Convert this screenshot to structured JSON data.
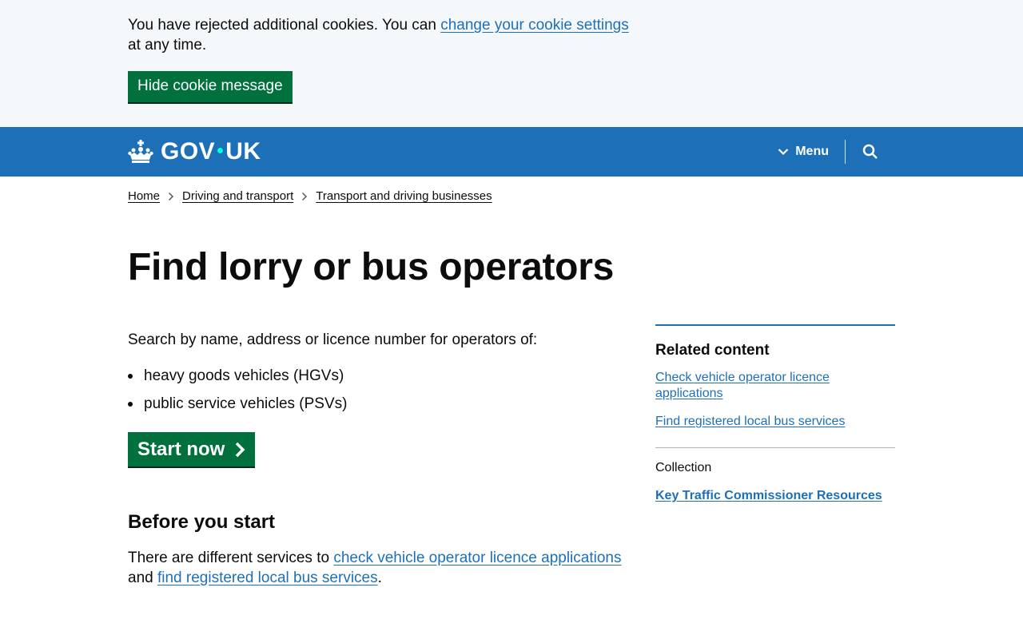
{
  "cookie_banner": {
    "message_before": "You have rejected additional cookies. You can ",
    "link_text": "change your cookie settings",
    "message_after": " at any time.",
    "hide_button": "Hide cookie message"
  },
  "header": {
    "logo_left": "GOV",
    "logo_right": "UK",
    "menu_label": "Menu",
    "icons": [
      "crown-icon",
      "chevron-down-icon",
      "search-icon"
    ]
  },
  "breadcrumb": [
    "Home",
    "Driving and transport",
    "Transport and driving businesses"
  ],
  "page": {
    "title": "Find lorry or bus operators",
    "intro": "Search by name, address or licence number for operators of:",
    "bullets": [
      "heavy goods vehicles (HGVs)",
      "public service vehicles (PSVs)"
    ],
    "start_button": "Start now",
    "before_heading": "Before you start",
    "before_text_1": "There are different services to ",
    "before_link_1": "check vehicle operator licence applications",
    "before_text_2": " and ",
    "before_link_2": "find registered local bus services",
    "before_text_3": "."
  },
  "sidebar": {
    "related_heading": "Related content",
    "related_links": [
      "Check vehicle operator licence applications",
      "Find registered local bus services"
    ],
    "collection_label": "Collection",
    "collection_links": [
      "Key Traffic Commissioner Resources"
    ]
  },
  "colors": {
    "brand_blue": "#1d70b8",
    "button_green": "#00703c",
    "banner_bg": "#f4f8fb",
    "logo_dot": "#00ffe0"
  }
}
